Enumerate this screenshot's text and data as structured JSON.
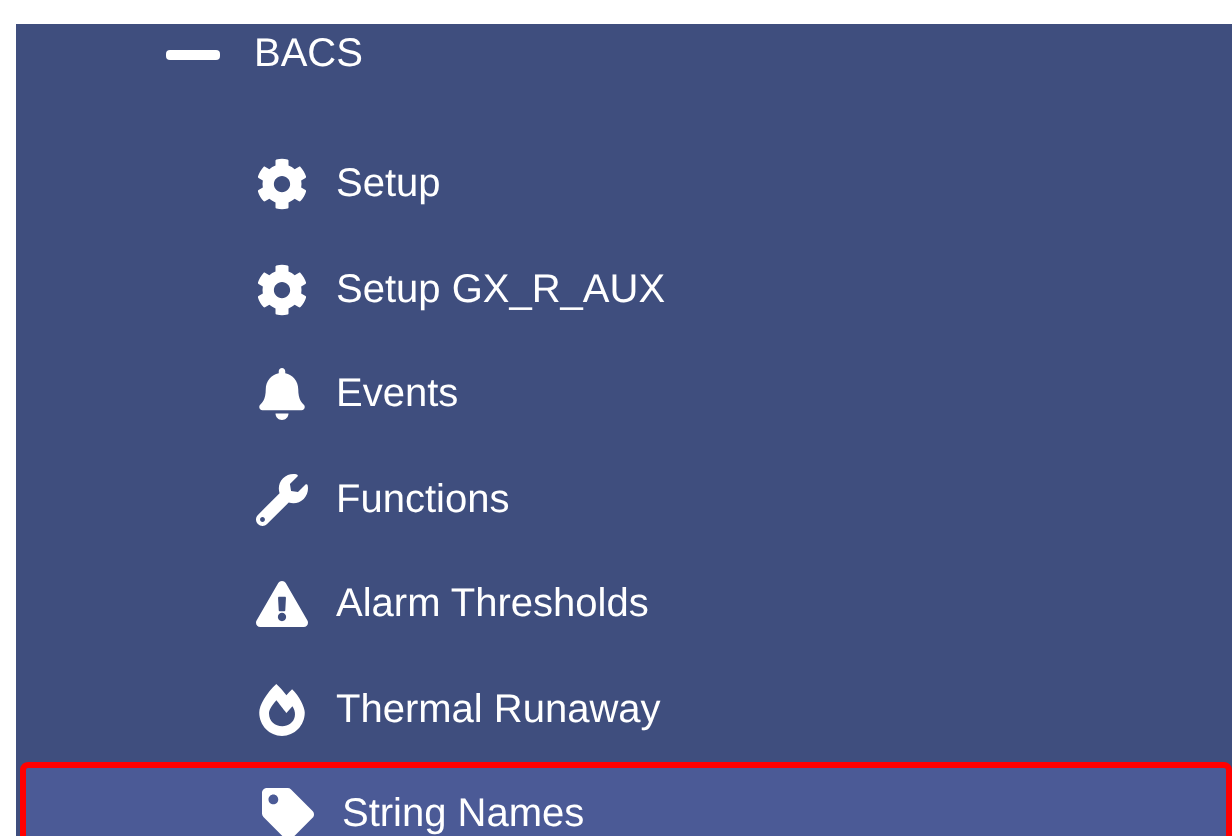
{
  "section": {
    "label": "BACS",
    "expanded": true,
    "items": [
      {
        "label": "Setup",
        "selected": false
      },
      {
        "label": "Setup GX_R_AUX",
        "selected": false
      },
      {
        "label": "Events",
        "selected": false
      },
      {
        "label": "Functions",
        "selected": false
      },
      {
        "label": "Alarm Thresholds",
        "selected": false
      },
      {
        "label": "Thermal Runaway",
        "selected": false
      },
      {
        "label": "String Names",
        "selected": true
      }
    ]
  }
}
